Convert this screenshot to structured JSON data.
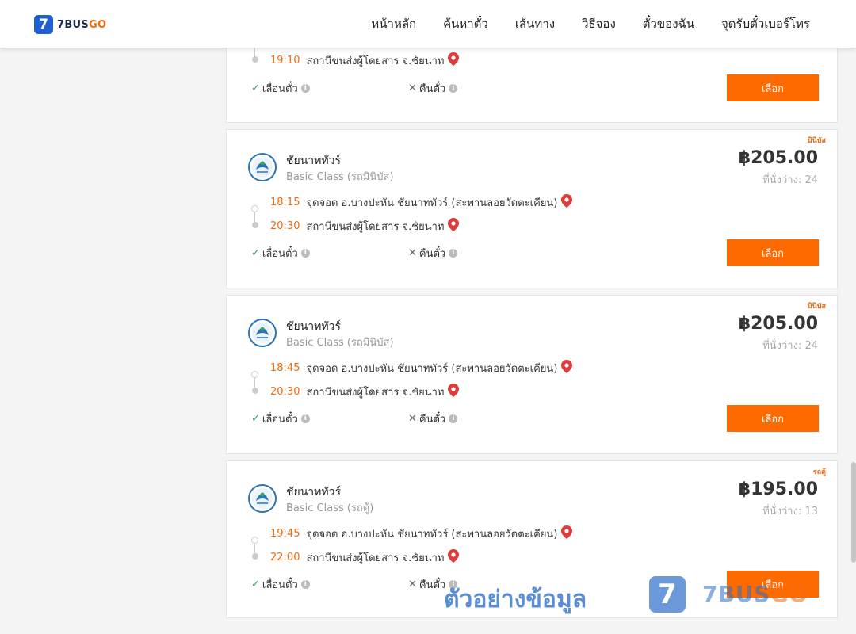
{
  "header": {
    "logo_mark": "7",
    "logo_text": "7BUS",
    "logo_text_accent": "GO",
    "nav": [
      "หน้าหลัก",
      "ค้นหาตั๋ว",
      "เส้นทาง",
      "วิธีจอง",
      "ตั๋วของฉัน",
      "จุดรับตั๋วเบอร์โทร"
    ]
  },
  "labels": {
    "change": "เลื่อนตั๋ว",
    "refund": "คืนตั๋ว",
    "select": "เลือก",
    "info": "i",
    "check": "✓",
    "cross": "✕"
  },
  "cards": [
    {
      "arrive_time": "19:10",
      "arrive_stop": "สถานีขนส่งผู้โดยสาร จ.ชัยนาท"
    },
    {
      "tag": "มินิบัส",
      "operator": "ชัยนาททัวร์",
      "class": "Basic Class (รถมินิบัส)",
      "price": "฿205.00",
      "seats": "ที่นั่งว่าง: 24",
      "depart_time": "18:15",
      "depart_stop": "จุดจอด อ.บางปะหัน ชัยนาททัวร์ (สะพานลอยวัดตะเคียน)",
      "arrive_time": "20:30",
      "arrive_stop": "สถานีขนส่งผู้โดยสาร จ.ชัยนาท"
    },
    {
      "tag": "มินิบัส",
      "operator": "ชัยนาททัวร์",
      "class": "Basic Class (รถมินิบัส)",
      "price": "฿205.00",
      "seats": "ที่นั่งว่าง: 24",
      "depart_time": "18:45",
      "depart_stop": "จุดจอด อ.บางปะหัน ชัยนาททัวร์ (สะพานลอยวัดตะเคียน)",
      "arrive_time": "20:30",
      "arrive_stop": "สถานีขนส่งผู้โดยสาร จ.ชัยนาท"
    },
    {
      "tag": "รถตู้",
      "operator": "ชัยนาททัวร์",
      "class": "Basic Class (รถตู้)",
      "price": "฿195.00",
      "seats": "ที่นั่งว่าง: 13",
      "depart_time": "19:45",
      "depart_stop": "จุดจอด อ.บางปะหัน ชัยนาททัวร์ (สะพานลอยวัดตะเคียน)",
      "arrive_time": "22:00",
      "arrive_stop": "สถานีขนส่งผู้โดยสาร จ.ชัยนาท"
    }
  ],
  "watermark": {
    "text": "ตัวอย่างข้อมูล",
    "icon": "7",
    "brand": "7BUS",
    "brand_accent": "GO"
  },
  "colors": {
    "accent": "#fd6a00",
    "brand_blue": "#1f5fd1",
    "time": "#f26b12",
    "ok": "#2fa84f"
  }
}
